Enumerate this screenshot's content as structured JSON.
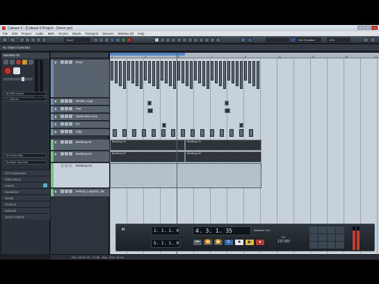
{
  "window": {
    "title": "Cubase 5 - [Cubase 5 Project - Demo.cpr]"
  },
  "menu": [
    "File",
    "Edit",
    "Project",
    "Audio",
    "MIDI",
    "Scores",
    "Media",
    "Transport",
    "Devices",
    "Window (6)",
    "Help"
  ],
  "toolbar": {
    "mode": "Touch",
    "snap": "Use Quantize",
    "quantize": "1/16"
  },
  "infoline": "No Object Selected",
  "inspector": {
    "track_name": "Bassline 01",
    "input": "All MIDI Inputs",
    "instrument": "1 - HALion",
    "drum_map": "No Drum Map",
    "bank": "No Bank Selected",
    "sections": [
      "VST Expression",
      "MIDI Inserts",
      "Inserts",
      "Equalizers",
      "Sends",
      "Channel",
      "Notepad",
      "Quick Controls"
    ]
  },
  "tracks": [
    {
      "name": "Keys",
      "color": "#6f8fb0"
    },
    {
      "name": "Shaker Loop",
      "color": "#6f8fb0"
    },
    {
      "name": "Pad",
      "color": "#6f8fb0"
    },
    {
      "name": "Synth Bass Line",
      "color": "#6f8fb0"
    },
    {
      "name": "FX",
      "color": "#6f8fb0"
    },
    {
      "name": "Clap",
      "color": "#6f8fb0"
    },
    {
      "name": "Beatloop 01",
      "color": "#7bbf8a"
    },
    {
      "name": "Beatloop 02",
      "color": "#7bbf8a"
    },
    {
      "name": "Beatloop 03",
      "color": "#7bbf8a"
    },
    {
      "name": "Melody_Loop001_4B",
      "color": "#7bbf8a"
    }
  ],
  "ruler": [
    "1",
    "3",
    "5",
    "7",
    "9",
    "11",
    "13",
    "15",
    "17"
  ],
  "events": {
    "beat1": "Beatloop 01",
    "beat1b": "Beatloop 01",
    "beat2": "Beatloop 02",
    "beat2b": "Beatloop 02"
  },
  "transport": {
    "left_locator": "1. 1. 1. 0",
    "right_locator": "5. 1. 1. 0",
    "position": "4. 3. 1. 35",
    "tempo": "120.000",
    "signature": "4/4",
    "marker_label": "Bassline 01A"
  },
  "statusbar": "Rec: 44100 Hz - 24 Bit - Max: 123h 20 min"
}
